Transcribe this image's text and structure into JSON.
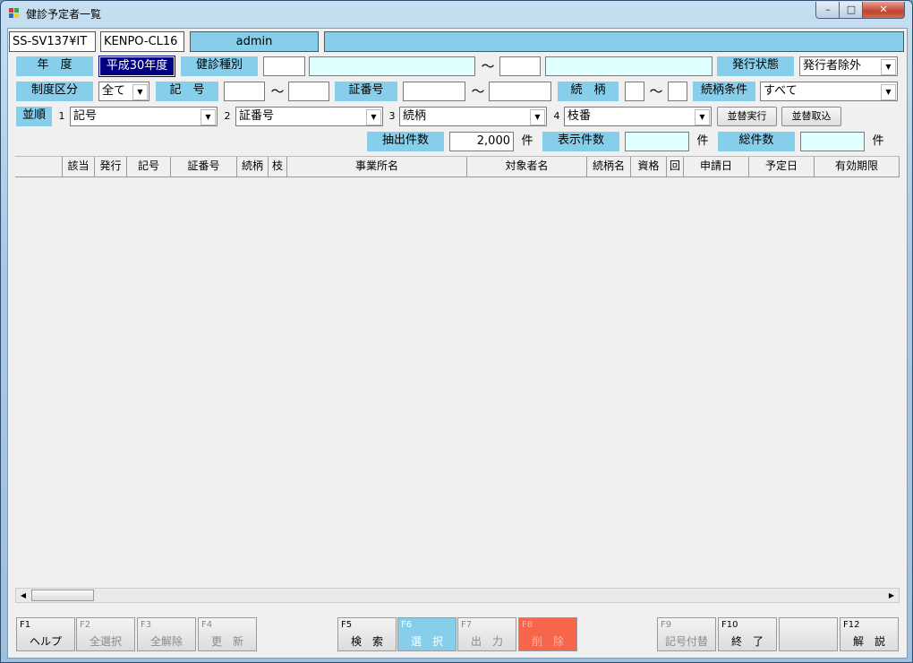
{
  "window": {
    "title": "健診予定者一覧",
    "min": "–",
    "max": "□",
    "close": "✕"
  },
  "info": {
    "server": "SS-SV137¥IT",
    "client": "KENPO-CL16",
    "user": "admin",
    "extra": ""
  },
  "row1": {
    "year_label": "年　度",
    "year_value": "平成30年度",
    "type_label": "健診種別",
    "type_code_from": "",
    "type_name_from": "",
    "tilde": "～",
    "type_code_to": "",
    "type_name_to": "",
    "issue_label": "発行状態",
    "issue_value": "発行者除外"
  },
  "row2": {
    "system_label": "制度区分",
    "system_value": "全て",
    "kigo_label": "記　号",
    "kigo_from": "",
    "tilde": "～",
    "kigo_to": "",
    "shoban_label": "証番号",
    "shoban_from": "",
    "shoban_to": "",
    "zokugara_label": "続　柄",
    "zokugara_from": "",
    "zokugara_to": "",
    "cond_label": "続柄条件",
    "cond_value": "すべて"
  },
  "sort": {
    "label": "並順",
    "items": [
      {
        "num": "1",
        "value": "記号"
      },
      {
        "num": "2",
        "value": "証番号"
      },
      {
        "num": "3",
        "value": "続柄"
      },
      {
        "num": "4",
        "value": "枝番"
      }
    ],
    "exec_button": "並替実行",
    "import_button": "並替取込"
  },
  "counts": {
    "extract_label": "抽出件数",
    "extract_value": "2,000",
    "unit": "件",
    "display_label": "表示件数",
    "display_value": "",
    "total_label": "総件数",
    "total_value": ""
  },
  "grid": {
    "columns": [
      "",
      "該当",
      "発行",
      "記号",
      "証番号",
      "続柄",
      "枝",
      "事業所名",
      "対象者名",
      "続柄名",
      "資格",
      "回",
      "申請日",
      "予定日",
      "有効期限"
    ]
  },
  "fkeys": [
    {
      "key": "F1",
      "label": "ヘルプ"
    },
    {
      "key": "F2",
      "label": "全選択"
    },
    {
      "key": "F3",
      "label": "全解除"
    },
    {
      "key": "F4",
      "label": "更　新"
    },
    {
      "key": "F5",
      "label": "検　索"
    },
    {
      "key": "F6",
      "label": "選　択"
    },
    {
      "key": "F7",
      "label": "出　力"
    },
    {
      "key": "F8",
      "label": "削　除"
    },
    {
      "key": "F9",
      "label": "記号付替"
    },
    {
      "key": "F10",
      "label": "終　了"
    },
    {
      "key": "",
      "label": ""
    },
    {
      "key": "F12",
      "label": "解　説"
    }
  ],
  "icons": {
    "dropdown": "chevron-down-icon",
    "scroll_left": "arrow-left-icon",
    "scroll_right": "arrow-right-icon",
    "app": "app-window-icon"
  },
  "colors": {
    "label_bg": "#87ceeb",
    "highlight_bg": "#000080",
    "delete_bg": "#f7654a"
  }
}
